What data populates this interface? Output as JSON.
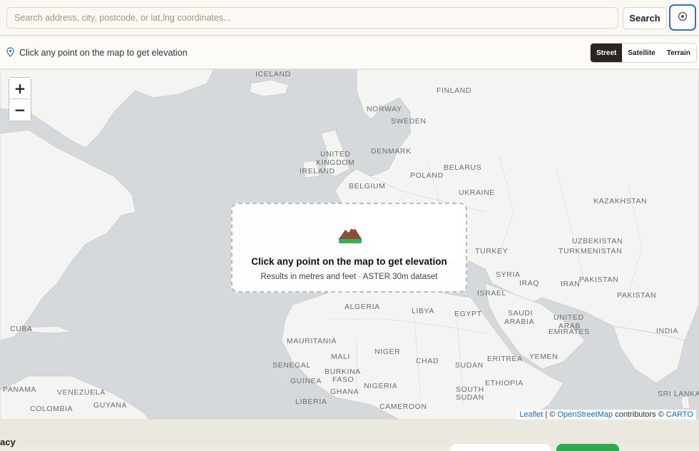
{
  "search": {
    "placeholder": "Search address, city, postcode, or lat,lng coordinates...",
    "value": "",
    "button_label": "Search"
  },
  "locate": {
    "icon": "target-icon"
  },
  "hint": {
    "icon": "map-pin-icon",
    "text": "Click any point on the map to get elevation"
  },
  "layers": [
    {
      "label": "Street",
      "active": true
    },
    {
      "label": "Satellite",
      "active": false
    },
    {
      "label": "Terrain",
      "active": false
    }
  ],
  "zoom": {
    "in_label": "+",
    "out_label": "−"
  },
  "map_labels": {
    "iceland": "ICELAND",
    "finland": "FINLAND",
    "norway": "NORWAY",
    "sweden": "SWEDEN",
    "united": "UNITED",
    "kingdom": "KINGDOM",
    "ireland": "IRELAND",
    "denmark": "DENMARK",
    "belarus": "BELARUS",
    "poland": "POLAND",
    "belgium": "BELGIUM",
    "ukraine": "UKRAINE",
    "kazakhstan": "KAZAKHSTAN",
    "uzbekistan": "UZBEKISTAN",
    "turkmenistan": "TURKMENISTAN",
    "turkey": "TURKEY",
    "syria": "SYRIA",
    "iraq": "IRAQ",
    "iran": "IRAN",
    "pakistan": "PAKISTAN",
    "israel": "ISRAEL",
    "algeria": "ALGERIA",
    "libya": "LIBYA",
    "egypt": "EGYPT",
    "saudi": "SAUDI",
    "arabia": "ARABIA",
    "uae1": "UNITED",
    "uae2": "ARAB",
    "uae3": "EMIRATES",
    "india": "INDIA",
    "cuba": "CUBA",
    "mauritania": "MAURITANIA",
    "mali": "MALI",
    "niger": "NIGER",
    "chad": "CHAD",
    "sudan": "SUDAN",
    "eritrea": "ERITREA",
    "yemen": "YEMEN",
    "senegal": "SENEGAL",
    "burkina": "BURKINA",
    "faso": "FASO",
    "guinea": "GUINEA",
    "ghana": "GHANA",
    "nigeria": "NIGERIA",
    "south": "SOUTH",
    "ssudan": "SUDAN",
    "ethiopia": "ETHIOPIA",
    "srilanka": "SRI LANKA",
    "panama": "PANAMA",
    "venezuela": "VENEZUELA",
    "guyana": "GUYANA",
    "colombia": "COLOMBIA",
    "liberia": "LIBERIA",
    "cameroon": "CAMEROON"
  },
  "overlay": {
    "icon": "mountain-icon",
    "title": "Click any point on the map to get elevation",
    "subtitle": "Results in metres and feet · ASTER 30m dataset"
  },
  "attribution": {
    "leaflet": "Leaflet",
    "sep": " | © ",
    "osm": "OpenStreetMap",
    "contrib": " contributors © ",
    "carto": "CARTO"
  },
  "footer": {
    "text": "acy"
  },
  "colors": {
    "water": "#d5d9dc",
    "land": "#f4f4f2",
    "accent": "#2a2520",
    "focus": "#3b6fb6",
    "green": "#2fa84f"
  }
}
